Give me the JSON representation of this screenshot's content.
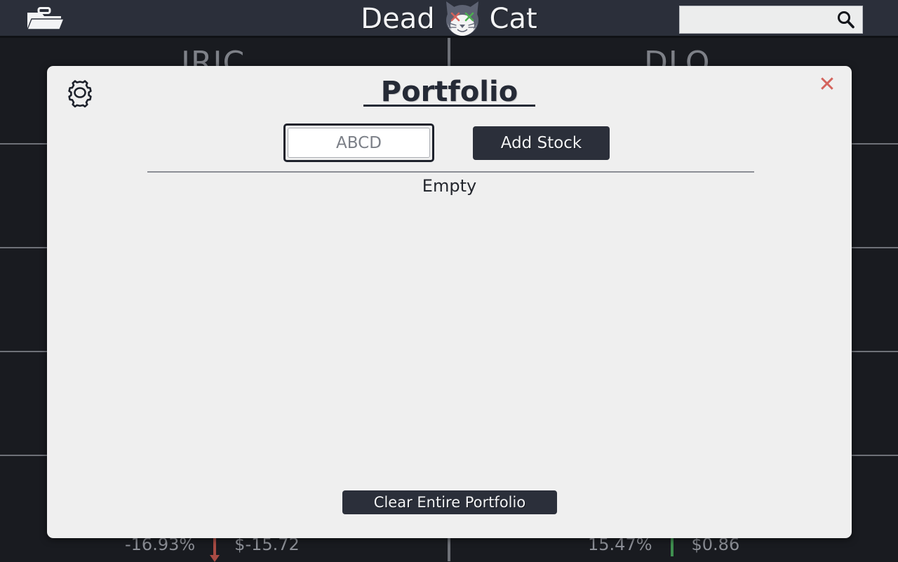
{
  "topbar": {
    "folder_icon": "briefcase-folder-icon",
    "brand_first": "Dead",
    "brand_second": "Cat",
    "brand_logo": "dead-cat-logo",
    "search_icon": "search-icon",
    "search_value": "",
    "search_placeholder": ""
  },
  "background": {
    "cards": [
      {
        "ticker": "JRJC",
        "percent": "-16.93%",
        "direction": "down",
        "change": "$-15.72",
        "arrow_color": "#a84b44"
      },
      {
        "ticker": "DLO",
        "percent": "15.47%",
        "direction": "up",
        "change": "$0.86",
        "arrow_color": "#3f8f4f"
      }
    ]
  },
  "modal": {
    "title": "Portfolio",
    "settings_icon": "gear-icon",
    "close_icon": "close-icon",
    "close_label": "✕",
    "close_color": "#d4635c",
    "ticker_input_value": "",
    "ticker_input_placeholder": "ABCD",
    "add_stock_label": "Add Stock",
    "empty_label": "Empty",
    "clear_label": "Clear Entire Portfolio"
  },
  "colors": {
    "topbar_bg": "#2b2f3a",
    "content_bg": "#191b20",
    "modal_bg": "#efefef",
    "accent_dark": "#2b2f3a",
    "danger": "#d4635c",
    "positive": "#3f8f4f",
    "negative": "#a84b44"
  }
}
